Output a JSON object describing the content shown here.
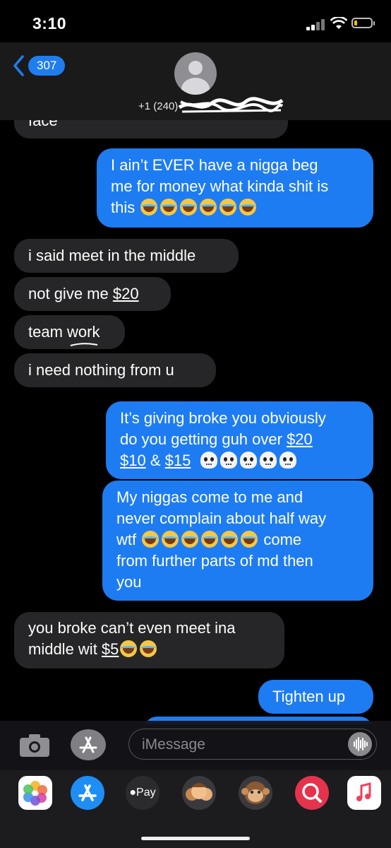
{
  "status": {
    "time": "3:10"
  },
  "header": {
    "back_count": "307",
    "contact": "+1 (240)"
  },
  "messages": [
    {
      "dir": "in",
      "text": "face"
    },
    {
      "dir": "out",
      "line1": "I ain’t EVER have a nigga beg",
      "line2": "me for money what kinda shit is",
      "line3": "this",
      "emoji": "laugh",
      "emoji_count": 6
    },
    {
      "dir": "in",
      "text": "i said meet in the middle"
    },
    {
      "dir": "in",
      "text_pre": "not give me ",
      "link": "$20"
    },
    {
      "dir": "in",
      "text": "team work"
    },
    {
      "dir": "in",
      "text": "i need nothing from u"
    },
    {
      "dir": "out",
      "line1": "It’s giving broke you obviously",
      "line2_pre": "do you getting guh over ",
      "line2_link": "$20",
      "line3_link1": "$10",
      "line3_amp": " & ",
      "line3_link2": "$15",
      "emoji": "skull",
      "emoji_count": 5
    },
    {
      "dir": "out",
      "line1": "My niggas come to me and",
      "line2": "never complain about half way",
      "line3_pre": "wtf",
      "line3_post": "come",
      "line4": "from further parts of md then",
      "line5": "you",
      "emoji": "laugh",
      "emoji_count": 6
    },
    {
      "dir": "in",
      "line1": "you broke can’t even meet ina",
      "line2_pre": "middle wit ",
      "line2_link": "$5",
      "emoji": "laugh",
      "emoji_count": 2
    },
    {
      "dir": "out",
      "text": "Tighten up"
    }
  ],
  "input": {
    "placeholder": "iMessage"
  },
  "drawer": {
    "apps": [
      "photos-icon",
      "app-store-icon",
      "apple-pay-icon",
      "memoji-icon",
      "animoji-icon",
      "search-images-icon",
      "music-icon"
    ],
    "apple_pay_label": "Pay"
  },
  "colors": {
    "outgoing": "#1e7cf2",
    "incoming": "#262628",
    "badge": "#1f7df0"
  }
}
